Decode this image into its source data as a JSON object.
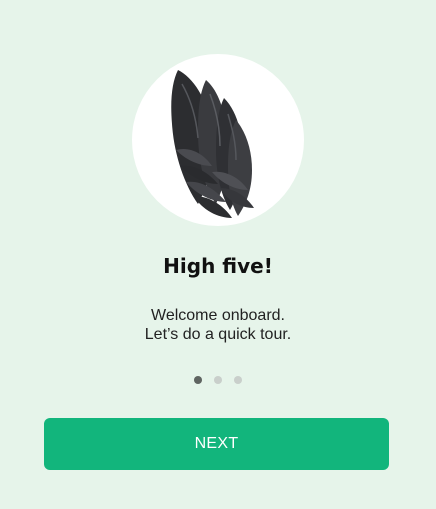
{
  "onboarding": {
    "illustration_icon": "wing-icon",
    "title": "High five!",
    "subtitle_line1": "Welcome onboard.",
    "subtitle_line2": "Let’s do a quick tour.",
    "pagination": {
      "total": 3,
      "active_index": 0
    },
    "next_label": "NEXT"
  },
  "colors": {
    "background": "#e6f4ea",
    "accent": "#12b57c",
    "dot_active": "#5f6461",
    "dot_inactive": "#c9cfcb"
  }
}
